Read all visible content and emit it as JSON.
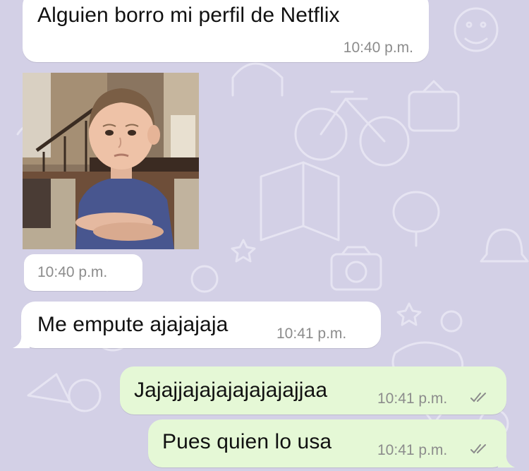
{
  "chat": {
    "messages": [
      {
        "direction": "incoming",
        "text": "Alguien borro mi perfil de Netflix",
        "time": "10:40 p.m."
      },
      {
        "direction": "incoming",
        "media": "photo-sticker",
        "text": "",
        "time": "10:40 p.m."
      },
      {
        "direction": "incoming",
        "text": "Me empute ajajajaja",
        "time": "10:41 p.m."
      },
      {
        "direction": "outgoing",
        "text": "Jajajjajajajajajajajjaa",
        "time": "10:41 p.m.",
        "status_icon": "double-check-icon"
      },
      {
        "direction": "outgoing",
        "text": "Pues quien lo usa",
        "time": "10:41 p.m.",
        "status_icon": "double-check-icon"
      }
    ]
  },
  "colors": {
    "wallpaper": "#d3d0e6",
    "incoming_bubble": "#ffffff",
    "outgoing_bubble": "#e5f8d6",
    "timestamp": "#8c8c8c",
    "doodle_stroke": "#e6e4f2"
  }
}
